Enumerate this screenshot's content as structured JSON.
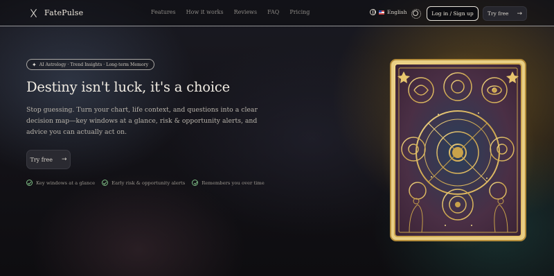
{
  "brand": {
    "name": "FatePulse",
    "icon": "x-icon"
  },
  "nav": {
    "links": [
      "Features",
      "How it works",
      "Reviews",
      "FAQ",
      "Pricing"
    ],
    "language": "English",
    "login_label": "Log in / Sign up",
    "try_label": "Try free"
  },
  "hero": {
    "badge": "AI Astrology · Trend Insights · Long-term Memory",
    "headline": "Destiny isn't luck, it's a choice",
    "subtitle": "Stop guessing. Turn your chart, life context, and questions into a clear decision map—key windows at a glance, risk & opportunity alerts, and advice you can actually act on.",
    "cta_label": "Try free",
    "features": [
      "Key windows at a glance",
      "Early risk & opportunity alerts",
      "Remembers you over time"
    ]
  },
  "colors": {
    "gold": "#c9a24a",
    "check": "#7fbf86",
    "card_purple": "#4a2f45"
  }
}
